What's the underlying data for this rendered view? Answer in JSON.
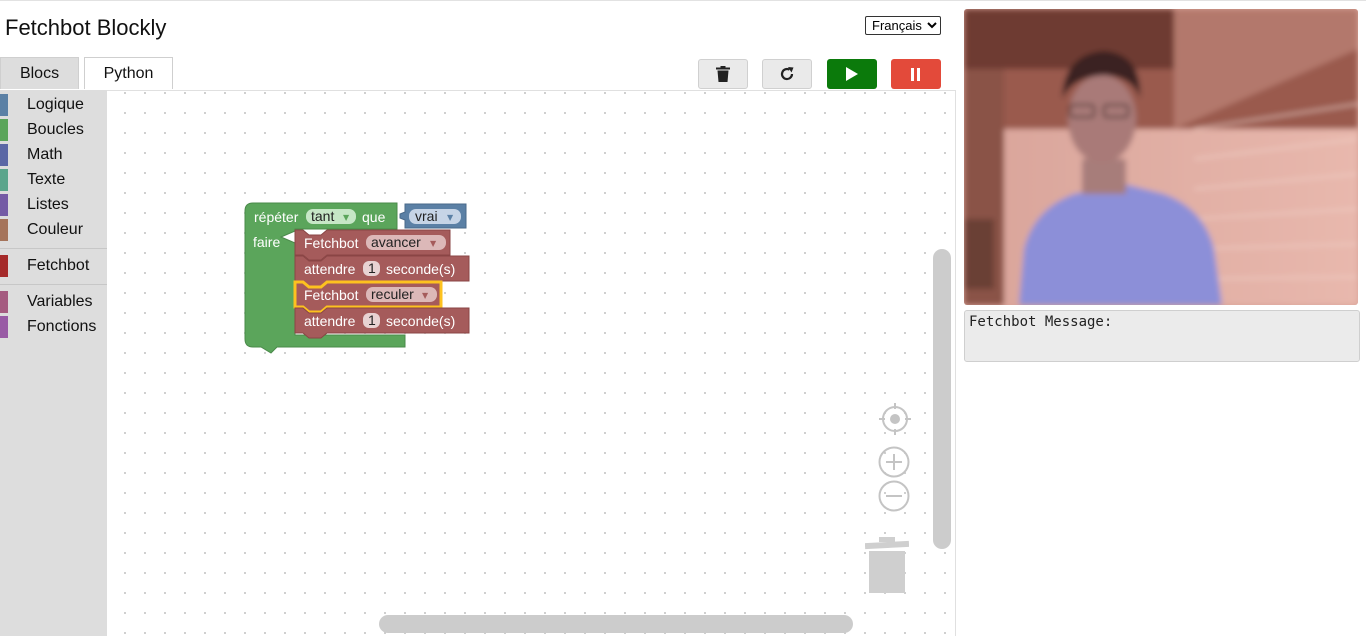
{
  "app": {
    "title": "Fetchbot Blockly"
  },
  "language": {
    "selected": "Français"
  },
  "tabs": [
    {
      "label": "Blocs"
    },
    {
      "label": "Python"
    }
  ],
  "toolbar": {
    "trash": "trash-icon",
    "reset": "refresh-icon",
    "run": "play-icon",
    "pause": "pause-icon"
  },
  "toolbox": {
    "items": [
      {
        "label": "Logique",
        "color": "#5b80a5"
      },
      {
        "label": "Boucles",
        "color": "#5ba55b"
      },
      {
        "label": "Math",
        "color": "#5b67a5"
      },
      {
        "label": "Texte",
        "color": "#5ba58c"
      },
      {
        "label": "Listes",
        "color": "#745ba5"
      },
      {
        "label": "Couleur",
        "color": "#a5745b"
      },
      {
        "label": "Fetchbot",
        "color": "#a52a2a"
      },
      {
        "label": "Variables",
        "color": "#a55b80"
      },
      {
        "label": "Fonctions",
        "color": "#995ba5"
      }
    ]
  },
  "blocks": {
    "repeat": {
      "word": "répéter",
      "mode": "tant",
      "cond_word": "que",
      "cond_value": "vrai",
      "do_word": "faire"
    },
    "statements": [
      {
        "kind": "move",
        "prefix": "Fetchbot",
        "value": "avancer"
      },
      {
        "kind": "wait",
        "prefix": "attendre",
        "number": "1",
        "suffix": "seconde(s)"
      },
      {
        "kind": "move",
        "prefix": "Fetchbot",
        "value": "reculer"
      },
      {
        "kind": "wait",
        "prefix": "attendre",
        "number": "1",
        "suffix": "seconde(s)"
      }
    ]
  },
  "colors": {
    "loop": "#5ba55b",
    "logic": "#5b80a5",
    "fetchbot": "#a55b5b",
    "highlight": "#fdc21f",
    "run": "#0b7a0b",
    "stop": "#e34a3a"
  },
  "message": {
    "label": "Fetchbot Message:"
  }
}
